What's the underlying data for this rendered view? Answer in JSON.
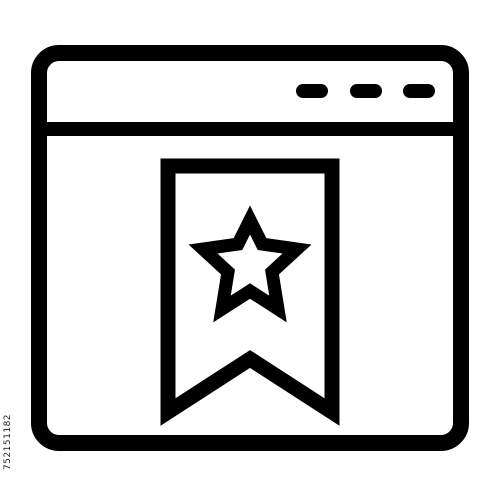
{
  "icon": {
    "name": "browser-bookmark-star-icon",
    "stroke_color": "#000000",
    "background_color": "#ffffff",
    "parts": [
      "browser-window-icon",
      "window-dots-icon",
      "bookmark-ribbon-icon",
      "star-icon"
    ]
  },
  "watermark": {
    "id_text": "752151182"
  }
}
